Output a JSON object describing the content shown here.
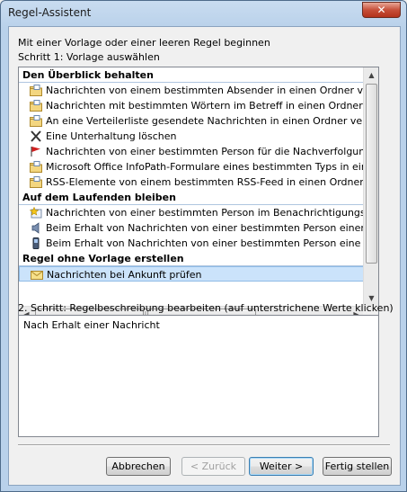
{
  "window": {
    "title": "Regel-Assistent",
    "close_glyph": "✕"
  },
  "intro": "Mit einer Vorlage oder einer leeren Regel beginnen",
  "step1_label": "Schritt 1: Vorlage auswählen",
  "templates": [
    {
      "group": "Den Überblick behalten",
      "items": [
        {
          "label": "Nachrichten von einem bestimmten Absender in einen Ordner verschieben",
          "icon": "move-folder-icon"
        },
        {
          "label": "Nachrichten mit bestimmten Wörtern im Betreff in einen Ordner verschieben",
          "icon": "move-folder-icon"
        },
        {
          "label": "An eine Verteilerliste gesendete Nachrichten in einen Ordner verschieben",
          "icon": "move-folder-icon"
        },
        {
          "label": "Eine Unterhaltung löschen",
          "icon": "delete-x-icon"
        },
        {
          "label": "Nachrichten von einer bestimmten Person für die Nachverfolgung kennzeichnen",
          "icon": "red-flag-icon"
        },
        {
          "label": "Microsoft Office InfoPath-Formulare eines bestimmten Typs in einen Ordner verschieben",
          "icon": "move-folder-icon"
        },
        {
          "label": "RSS-Elemente von einem bestimmten RSS-Feed in einen Ordner verschieben",
          "icon": "move-folder-icon"
        }
      ]
    },
    {
      "group": "Auf dem Laufenden bleiben",
      "items": [
        {
          "label": "Nachrichten von einer bestimmten Person im Benachrichtigungsfenster für neue Elemente anzeigen",
          "icon": "alert-star-icon"
        },
        {
          "label": "Beim Erhalt von Nachrichten von einer bestimmten Person einen Sound wiedergeben",
          "icon": "speaker-icon"
        },
        {
          "label": "Beim Erhalt von Nachrichten von einer bestimmten Person eine Benachrichtigung senden",
          "icon": "mobile-phone-icon"
        }
      ]
    },
    {
      "group": "Regel ohne Vorlage erstellen",
      "items": [
        {
          "label": "Nachrichten bei Ankunft prüfen",
          "icon": "envelope-icon",
          "selected": true
        }
      ]
    }
  ],
  "step2_label": "2. Schritt: Regelbeschreibung bearbeiten (auf unterstrichene Werte klicken)",
  "description": "Nach Erhalt einer Nachricht",
  "buttons": {
    "cancel": "Abbrechen",
    "back": "< Zurück",
    "next": "Weiter >",
    "finish": "Fertig stellen"
  },
  "colors": {
    "selection": "#cbe3fb",
    "group_rule": "#b0c6e0",
    "title_bar": "#b9d1ea",
    "close": "#c7503a"
  }
}
